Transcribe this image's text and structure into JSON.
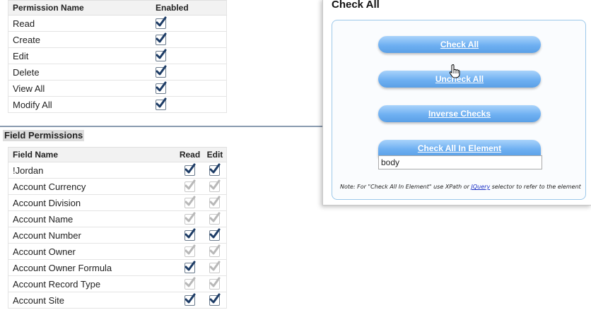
{
  "permissions_table": {
    "headers": [
      "Permission Name",
      "Enabled"
    ],
    "rows": [
      {
        "name": "Read",
        "enabled": true
      },
      {
        "name": "Create",
        "enabled": true
      },
      {
        "name": "Edit",
        "enabled": true
      },
      {
        "name": "Delete",
        "enabled": true
      },
      {
        "name": "View All",
        "enabled": true
      },
      {
        "name": "Modify All",
        "enabled": true
      }
    ]
  },
  "field_permissions": {
    "title": "Field Permissions",
    "headers": [
      "Field Name",
      "Read",
      "Edit"
    ],
    "rows": [
      {
        "name": "!Jordan",
        "read": "checked",
        "edit": "checked"
      },
      {
        "name": "Account Currency",
        "read": "disabled",
        "edit": "disabled"
      },
      {
        "name": "Account Division",
        "read": "disabled",
        "edit": "disabled"
      },
      {
        "name": "Account Name",
        "read": "disabled",
        "edit": "disabled"
      },
      {
        "name": "Account Number",
        "read": "checked",
        "edit": "checked"
      },
      {
        "name": "Account Owner",
        "read": "disabled",
        "edit": "disabled"
      },
      {
        "name": "Account Owner Formula",
        "read": "checked",
        "edit": "disabled"
      },
      {
        "name": "Account Record Type",
        "read": "disabled",
        "edit": "disabled"
      },
      {
        "name": "Account Site",
        "read": "checked",
        "edit": "checked"
      }
    ]
  },
  "panel": {
    "title": "Check All",
    "buttons": {
      "check_all": "Check All",
      "uncheck_all": "Uncheck All",
      "inverse": "Inverse Checks",
      "check_all_in_element": "Check All In Element"
    },
    "element_input_value": "body",
    "note_prefix": "Note: For \"Check All In Element\" use XPath or ",
    "note_link": "JQuery",
    "note_suffix": " selector to refer to the element"
  },
  "colors": {
    "button_top": "#a9d3fb",
    "button_bottom": "#5aa0e6",
    "panel_border": "#9cc8ea",
    "separator": "#8a9bb0",
    "check_mark": "#1d3c66",
    "check_mark_disabled": "#b8b8b8"
  },
  "icons": {
    "checkbox": "checkbox-checked-icon",
    "cursor": "hand-pointer-icon"
  }
}
